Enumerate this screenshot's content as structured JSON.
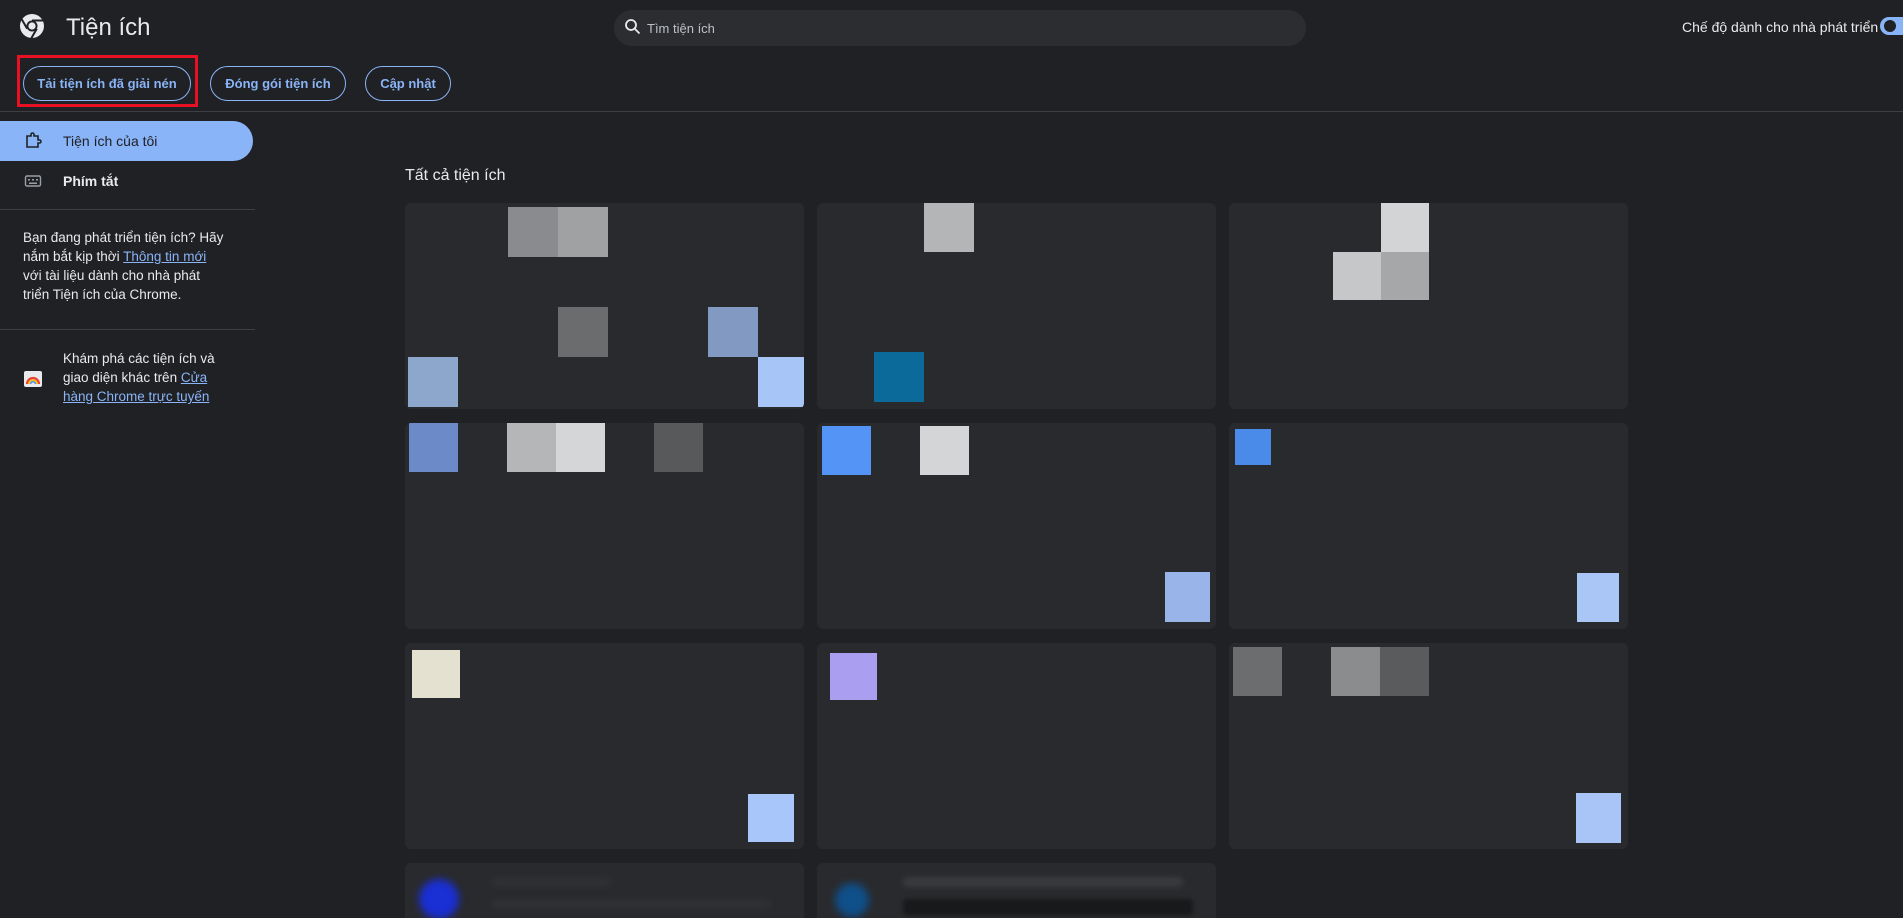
{
  "header": {
    "title": "Tiện ích",
    "search_placeholder": "Tìm tiện ích",
    "dev_mode_label": "Chế độ dành cho nhà phát triển"
  },
  "toolbar": {
    "load_unpacked": "Tải tiện ích đã giải nén",
    "pack_extension": "Đóng gói tiện ích",
    "update": "Cập nhật"
  },
  "sidebar": {
    "items": [
      {
        "label": "Tiện ích của tôi"
      },
      {
        "label": "Phím tắt"
      }
    ],
    "dev_note": {
      "text_before": "Bạn đang phát triển tiện ích? Hãy nắm bắt kịp thời ",
      "link": "Thông tin mới",
      "text_after": " với tài liệu dành cho nhà phát triển Tiện ích của Chrome."
    },
    "store_note": {
      "text_before": "Khám phá các tiện ích và giao diện khác trên ",
      "link": "Cửa hàng Chrome trực tuyến"
    }
  },
  "main": {
    "section_title": "Tất cả tiện ích"
  },
  "colors": {
    "background": "#202124",
    "card": "#292a2d",
    "accent": "#8ab4f8",
    "highlight": "#e81123"
  }
}
